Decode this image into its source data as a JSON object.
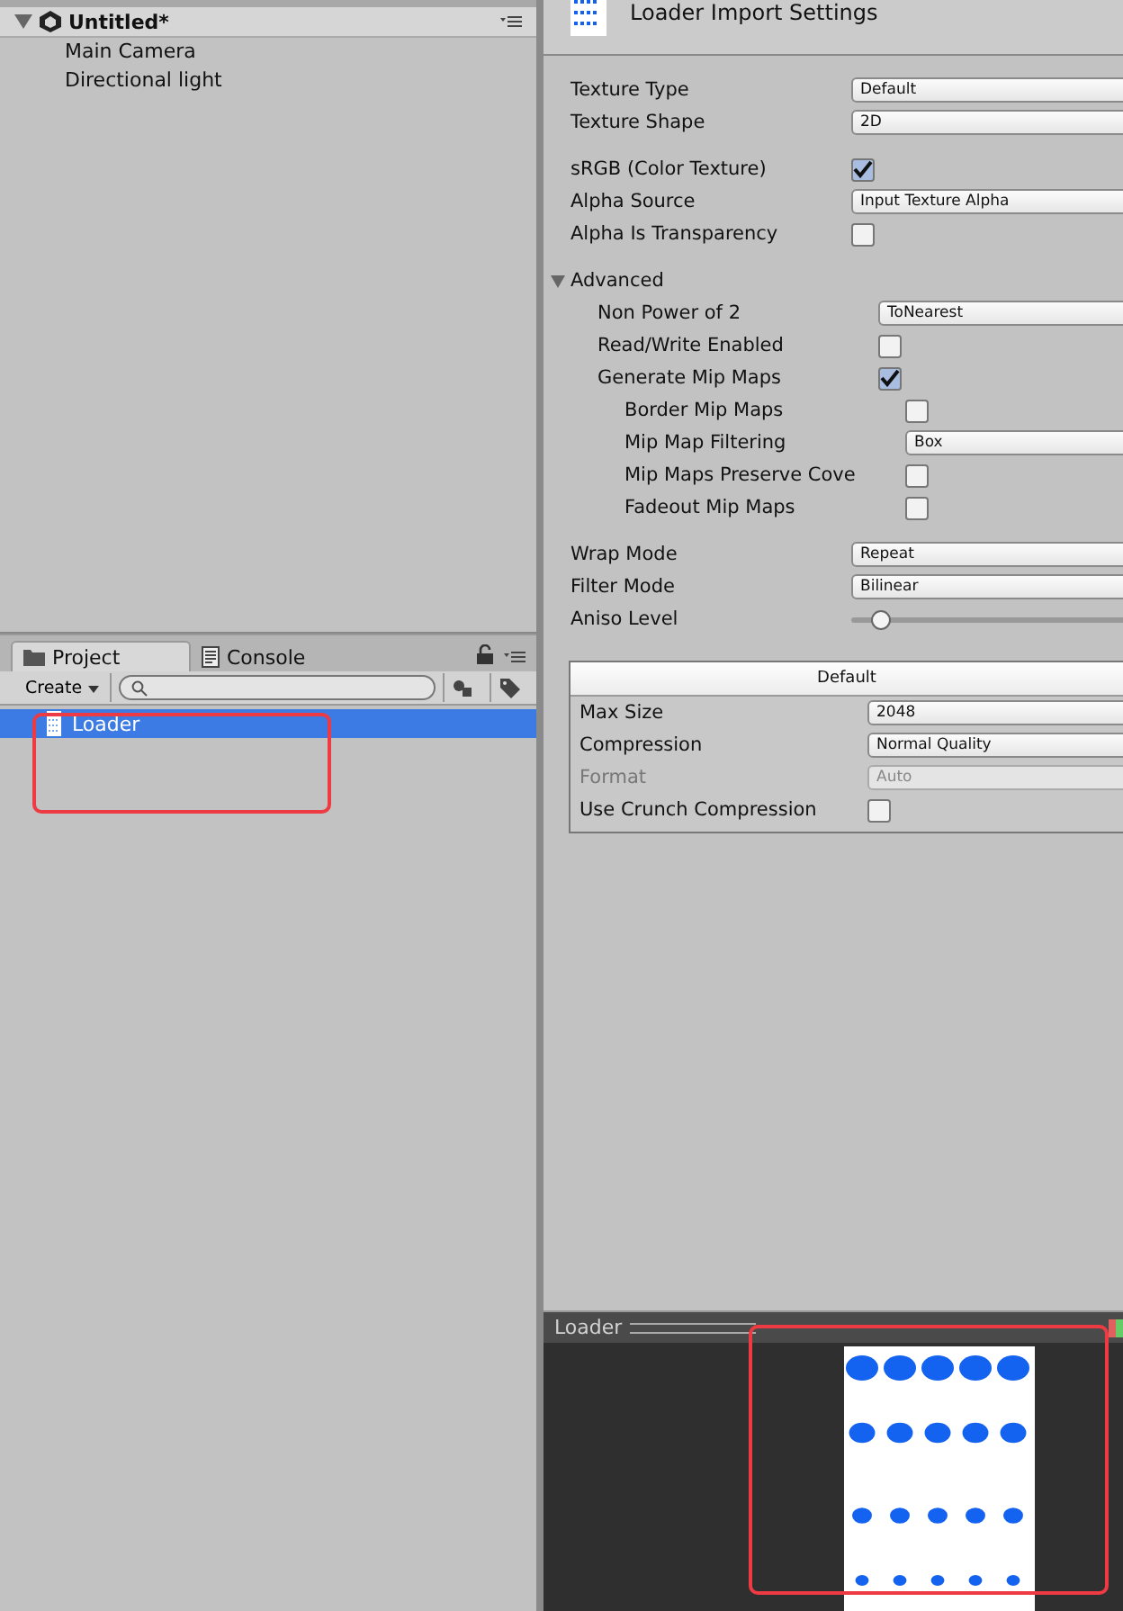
{
  "hierarchy": {
    "scene": "Untitled*",
    "expanded": true,
    "items": [
      "Main Camera",
      "Directional light"
    ]
  },
  "project": {
    "tabs": [
      {
        "label": "Project",
        "selected": true
      },
      {
        "label": "Console",
        "selected": false
      }
    ],
    "create": "Create",
    "assets": [
      {
        "name": "Loader",
        "selected": true
      }
    ]
  },
  "inspector": {
    "title": "Loader Import Settings",
    "sections": [
      {
        "rows": [
          {
            "kind": "dropdown",
            "label": "Texture Type",
            "value": "Default"
          },
          {
            "kind": "dropdown",
            "label": "Texture Shape",
            "value": "2D"
          }
        ]
      },
      {
        "rows": [
          {
            "kind": "checkbox",
            "label": "sRGB (Color Texture)",
            "checked": true
          },
          {
            "kind": "dropdown",
            "label": "Alpha Source",
            "value": "Input Texture Alpha"
          },
          {
            "kind": "checkbox",
            "label": "Alpha Is Transparency",
            "checked": false
          }
        ]
      },
      {
        "rows": [
          {
            "kind": "foldout",
            "label": "Advanced",
            "expanded": true,
            "children": [
              {
                "kind": "dropdown",
                "label": "Non Power of 2",
                "value": "ToNearest"
              },
              {
                "kind": "checkbox",
                "label": "Read/Write Enabled",
                "checked": false
              },
              {
                "kind": "checkbox",
                "label": "Generate Mip Maps",
                "checked": true,
                "children": [
                  {
                    "kind": "checkbox",
                    "label": "Border Mip Maps",
                    "checked": false
                  },
                  {
                    "kind": "dropdown",
                    "label": "Mip Map Filtering",
                    "value": "Box"
                  },
                  {
                    "kind": "checkbox",
                    "label": "Mip Maps Preserve Cove",
                    "checked": false
                  },
                  {
                    "kind": "checkbox",
                    "label": "Fadeout Mip Maps",
                    "checked": false
                  }
                ]
              }
            ]
          }
        ]
      },
      {
        "rows": [
          {
            "kind": "dropdown",
            "label": "Wrap Mode",
            "value": "Repeat"
          },
          {
            "kind": "dropdown",
            "label": "Filter Mode",
            "value": "Bilinear"
          },
          {
            "kind": "slider",
            "label": "Aniso Level",
            "level": 0.08
          }
        ]
      }
    ],
    "platform": {
      "header": "Default",
      "rows": [
        {
          "kind": "dropdown",
          "label": "Max Size",
          "value": "2048",
          "disabled": false
        },
        {
          "kind": "dropdown",
          "label": "Compression",
          "value": "Normal Quality",
          "disabled": false
        },
        {
          "kind": "dropdown",
          "label": "Format",
          "value": "Auto",
          "disabled": true
        },
        {
          "kind": "checkbox",
          "label": "Use Crunch Compression",
          "checked": false,
          "disabled": false
        }
      ]
    }
  },
  "preview": {
    "title": "Loader"
  }
}
